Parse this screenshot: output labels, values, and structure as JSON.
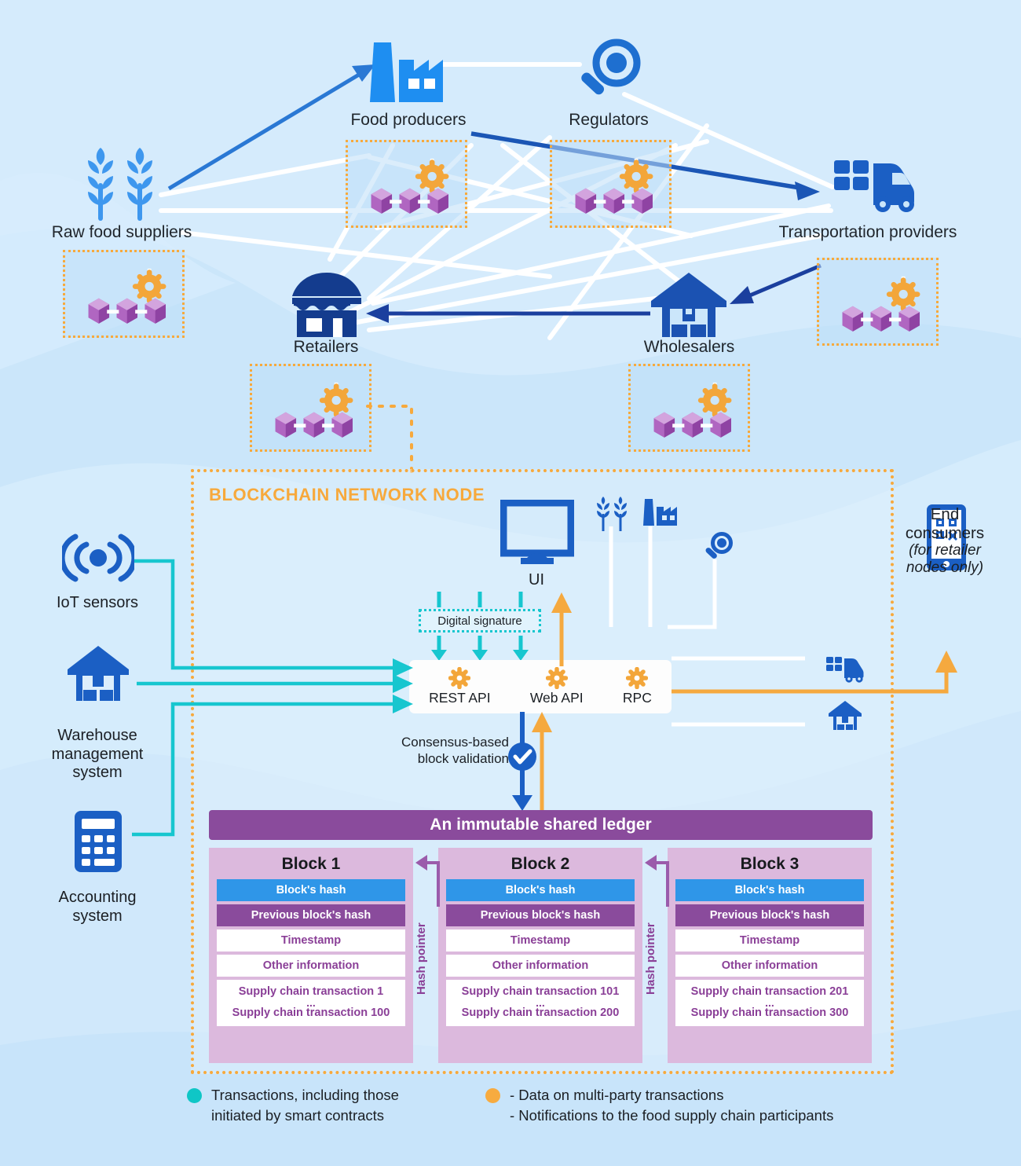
{
  "colors": {
    "background": "#cbe6fa",
    "orange": "#f7a93c",
    "teal": "#17c6cf",
    "blue_dark": "#1a50a8",
    "blue_mid": "#1e6fd0",
    "blue_light": "#3e97ee",
    "purple": "#8a4b9c",
    "purple_light": "#dcb9dd",
    "hash_blue": "#2f96e8",
    "white": "#ffffff"
  },
  "supply_chain": {
    "participants": [
      {
        "id": "raw-food-suppliers",
        "label": "Raw food suppliers",
        "icon": "wheat-icon"
      },
      {
        "id": "food-producers",
        "label": "Food producers",
        "icon": "factory-icon"
      },
      {
        "id": "regulators",
        "label": "Regulators",
        "icon": "magnifier-icon"
      },
      {
        "id": "transportation-providers",
        "label": "Transportation providers",
        "icon": "truck-icon"
      },
      {
        "id": "retailers",
        "label": "Retailers",
        "icon": "store-icon"
      },
      {
        "id": "wholesalers",
        "label": "Wholesalers",
        "icon": "warehouse-icon"
      }
    ]
  },
  "blockchain_node": {
    "title": "BLOCKCHAIN NETWORK NODE",
    "ui_label": "UI",
    "digital_signature": "Digital signature",
    "consensus": "Consensus-based\nblock validation",
    "consensus_line1": "Consensus-based",
    "consensus_line2": "block validation",
    "apis": [
      {
        "label": "REST API",
        "icon": "gear-icon"
      },
      {
        "label": "Web API",
        "icon": "gear-icon"
      },
      {
        "label": "RPC",
        "icon": "gear-icon"
      }
    ]
  },
  "external_systems": [
    {
      "id": "iot-sensors",
      "icon": "signal-icon",
      "line1": "IoT sensors",
      "line2": "",
      "line3": ""
    },
    {
      "id": "warehouse-management-system",
      "icon": "warehouse-icon",
      "line1": "Warehouse",
      "line2": "management",
      "line3": "system"
    },
    {
      "id": "accounting-system",
      "icon": "calculator-icon",
      "line1": "Accounting",
      "line2": "system",
      "line3": ""
    }
  ],
  "end_consumers": {
    "icon": "smartphone-qr-icon",
    "line1": "End",
    "line2": "consumers",
    "note1": "(for retailer",
    "note2": "nodes only)"
  },
  "ledger": {
    "title": "An immutable shared ledger",
    "hash_pointer_label": "Hash pointer",
    "rows": {
      "hash": "Block's hash",
      "previous": "Previous block's hash",
      "timestamp": "Timestamp",
      "other": "Other information",
      "ellipsis": "..."
    },
    "blocks": [
      {
        "title": "Block 1",
        "tx_first": "Supply chain transaction 1",
        "tx_last": "Supply chain transaction 100"
      },
      {
        "title": "Block 2",
        "tx_first": "Supply chain transaction 101",
        "tx_last": "Supply chain transaction 200"
      },
      {
        "title": "Block 3",
        "tx_first": "Supply chain transaction 201",
        "tx_last": "Supply chain transaction 300"
      }
    ]
  },
  "legend": [
    {
      "color": "#0fc6c6",
      "line1": "Transactions, including those",
      "line2": "initiated by smart contracts"
    },
    {
      "color": "#f7ab40",
      "line1": "- Data on multi-party transactions",
      "line2": "- Notifications to the food supply chain participants"
    }
  ]
}
